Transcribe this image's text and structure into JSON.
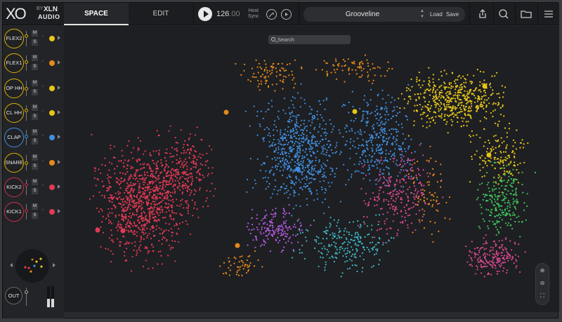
{
  "header": {
    "logo_text": "XO",
    "logo_by": "BY",
    "logo_brand": "XLN",
    "logo_audio": "AUDIO",
    "tab_space": "SPACE",
    "tab_edit": "EDIT",
    "tempo_whole": "126",
    "tempo_decimal": ".00",
    "host_sync_line1": "Host",
    "host_sync_line2": "Sync",
    "preset_name": "Grooveline",
    "load_label": "Load",
    "save_label": "Save"
  },
  "colors": {
    "yellow": "#e6c619",
    "orange": "#e48a1a",
    "blue": "#3f8fe0",
    "red": "#e23a55",
    "pink": "#d6488f",
    "purple": "#b35ae0",
    "teal": "#3fb6c4",
    "green": "#3ec45a",
    "ring_yellow": "#d9b000",
    "ring_blue": "#3f8fe0",
    "ring_red": "#c6324b"
  },
  "channels": [
    {
      "label": "FLEX2",
      "m": "M",
      "s": "S",
      "x": "×",
      "color": "#e6c619",
      "ring": "#d9b000"
    },
    {
      "label": "FLEX1",
      "m": "M",
      "s": "S",
      "x": "×",
      "color": "#e48a1a",
      "ring": "#d9b000"
    },
    {
      "label": "OP HH",
      "m": "M",
      "s": "S",
      "x": "×",
      "color": "#e6c619",
      "ring": "#d9b000"
    },
    {
      "label": "CL HH",
      "m": "M",
      "s": "S",
      "x": "×",
      "color": "#e6c619",
      "ring": "#d9b000"
    },
    {
      "label": "CLAP",
      "m": "M",
      "s": "S",
      "x": "×",
      "color": "#3f8fe0",
      "ring": "#3f8fe0"
    },
    {
      "label": "SNARE",
      "m": "M",
      "s": "S",
      "x": "×",
      "color": "#e48a1a",
      "ring": "#d9b000"
    },
    {
      "label": "KICK2",
      "m": "M",
      "s": "S",
      "x": "×",
      "color": "#e23a55",
      "ring": "#c6324b"
    },
    {
      "label": "KICK1",
      "m": "M",
      "s": "S",
      "x": "×",
      "color": "#e23a55",
      "ring": "#c6324b"
    }
  ],
  "output": {
    "label": "OUT"
  },
  "space": {
    "search_placeholder": "Search"
  },
  "icons": {
    "play": "play-icon",
    "tap": "tap-icon",
    "sync": "sync-icon",
    "share": "share-icon",
    "search": "search-icon",
    "folder": "folder-icon",
    "menu": "menu-icon",
    "zoom_in": "zoom-in-icon",
    "zoom_out": "zoom-out-icon",
    "fit": "fit-icon"
  }
}
